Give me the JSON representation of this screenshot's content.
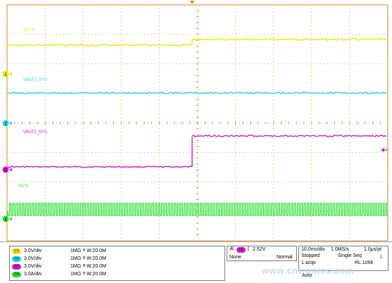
{
  "colors": {
    "background": "#ffffff",
    "grid": "#d28a2a",
    "ch1": "#f2e500",
    "ch2": "#22d6ea",
    "ch3": "#d21ad2",
    "ch4": "#22e02a"
  },
  "channels": [
    {
      "id": "C1",
      "marker": "1",
      "trace_label": "VSYS",
      "scale": "3.0V/div",
      "impedance": "1MΩ",
      "bw": "B",
      "bw_value": "W:20.0M"
    },
    {
      "id": "C2",
      "marker": "2",
      "trace_label": "VBAT1_SYS",
      "scale": "3.0V/div",
      "impedance": "1MΩ",
      "bw": "B",
      "bw_value": "W:20.0M"
    },
    {
      "id": "C3",
      "marker": "3",
      "trace_label": "VBAT2_SYS",
      "scale": "3.0V/div",
      "impedance": "1MΩ",
      "bw": "B",
      "bw_value": "W:20.0M"
    },
    {
      "id": "C4",
      "marker": "4",
      "trace_label": "ISYS",
      "scale": "3.0A/div",
      "impedance": "1MΩ",
      "bw": "B",
      "bw_value": "W:20.0M"
    }
  ],
  "trigger": {
    "mode_letter": "A'",
    "source": "C3",
    "slope": "∫",
    "level": "2.52V",
    "coupling": "None",
    "sweep": "Normal"
  },
  "acquisition": {
    "timebase": "10.0ms/div",
    "sample_rate": "1.0MS/s",
    "resolution": "1.0μs/pt",
    "state": "Stopped",
    "mode": "Single Seq",
    "acqs": "1 acqs",
    "record": "RL:100k",
    "trigger_mode": "Auto"
  },
  "watermark": "www.cntronics.com"
}
